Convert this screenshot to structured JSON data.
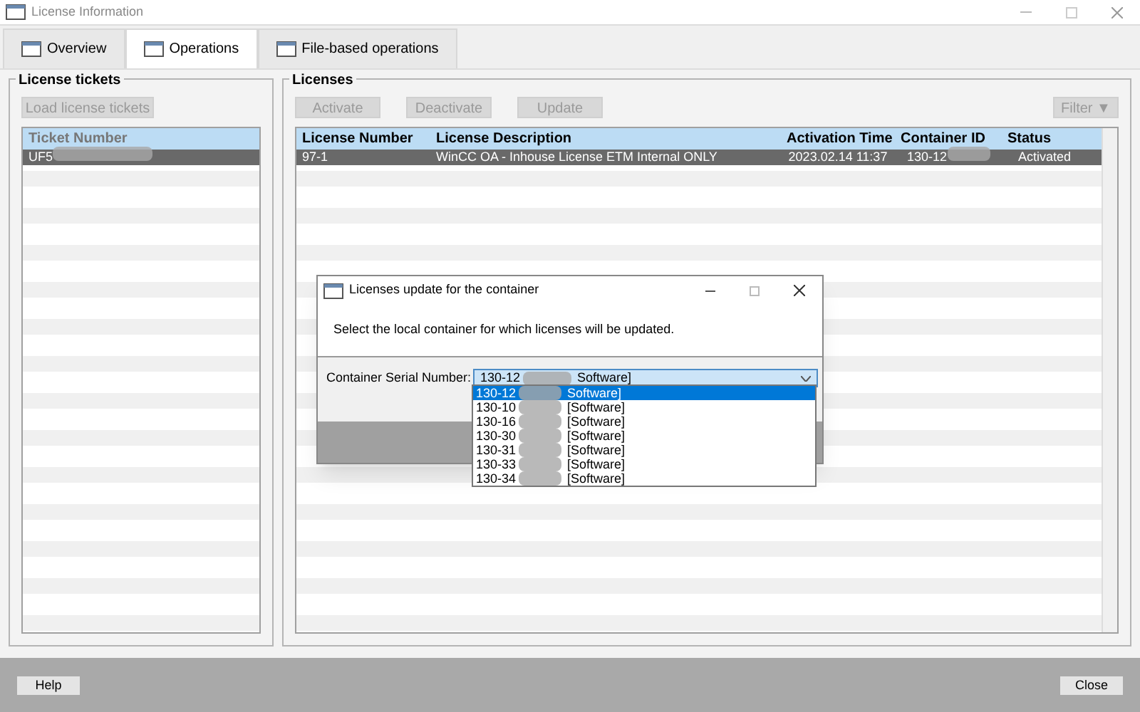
{
  "window": {
    "title": "License Information"
  },
  "tabs": [
    {
      "label": "Overview",
      "selected": false
    },
    {
      "label": "Operations",
      "selected": true
    },
    {
      "label": "File-based operations",
      "selected": false
    }
  ],
  "tickets": {
    "title": "License tickets",
    "load_button": {
      "label": "Load license tickets",
      "disabled": true
    },
    "columns": [
      "Ticket Number"
    ],
    "rows": [
      {
        "cells": [
          "UF5"
        ],
        "selected": true
      }
    ]
  },
  "licenses": {
    "title": "Licenses",
    "buttons": [
      {
        "label": "Activate",
        "disabled": true
      },
      {
        "label": "Deactivate",
        "disabled": true
      },
      {
        "label": "Update",
        "disabled": true
      }
    ],
    "filter": {
      "label": "Filter",
      "glyph": "▼",
      "disabled": true
    },
    "columns": [
      "License Number",
      "License Description",
      "Activation Time",
      "Container ID",
      "Status"
    ],
    "rows": [
      {
        "cells": [
          "97-1",
          "WinCC OA - Inhouse License ETM Internal ONLY",
          "2023.02.14 11:37",
          "130-12",
          "Activated"
        ],
        "selected": true
      }
    ]
  },
  "dialog": {
    "title": "Licenses update for the container",
    "message": "Select the local container for which licenses will be updated.",
    "label": "Container Serial Number:",
    "value": "130-12",
    "value_suffix": "Software]",
    "options": [
      {
        "prefix": "130-12",
        "suffix": "Software]",
        "selected": true
      },
      {
        "prefix": "130-10",
        "suffix": "[Software]",
        "selected": false
      },
      {
        "prefix": "130-16",
        "suffix": "[Software]",
        "selected": false
      },
      {
        "prefix": "130-30",
        "suffix": "[Software]",
        "selected": false
      },
      {
        "prefix": "130-31",
        "suffix": "[Software]",
        "selected": false
      },
      {
        "prefix": "130-33",
        "suffix": "[Software]",
        "selected": false
      },
      {
        "prefix": "130-34",
        "suffix": "[Software]",
        "selected": false
      }
    ]
  },
  "footer": {
    "help": "Help",
    "close": "Close"
  }
}
